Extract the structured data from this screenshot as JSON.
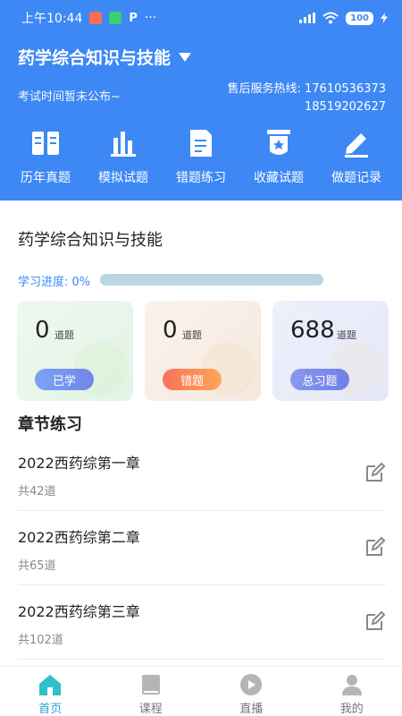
{
  "status_bar": {
    "time": "上午10:44",
    "more": "···",
    "battery": "100"
  },
  "header": {
    "subject": "药学综合知识与技能",
    "dropdown_icon": "triangle-down",
    "exam_time": "考试时间暂未公布~",
    "hotline_label_1": "售后服务热线: 17610536373",
    "hotline_2": "18519202627"
  },
  "nav": {
    "items": [
      {
        "label": "历年真题",
        "icon": "book-icon"
      },
      {
        "label": "模拟试题",
        "icon": "bar-chart-icon"
      },
      {
        "label": "错题练习",
        "icon": "document-icon"
      },
      {
        "label": "收藏试题",
        "icon": "bookmark-icon"
      },
      {
        "label": "做题记录",
        "icon": "pencil-icon"
      }
    ]
  },
  "main": {
    "title": "药学综合知识与技能",
    "progress_label": "学习进度: 0%",
    "progress": 0,
    "stats": [
      {
        "value": "0",
        "unit": "道题",
        "badge": "已学"
      },
      {
        "value": "0",
        "unit": "道题",
        "badge": "错题"
      },
      {
        "value": "688",
        "unit": "道题",
        "badge": "总习题"
      }
    ],
    "section_title": "章节练习",
    "chapters": [
      {
        "name": "2022西药综第一章",
        "count": "共42道"
      },
      {
        "name": "2022西药综第二章",
        "count": "共65道"
      },
      {
        "name": "2022西药综第三章",
        "count": "共102道"
      }
    ]
  },
  "bottom_nav": {
    "tabs": [
      {
        "label": "首页",
        "icon": "home-icon",
        "active": true
      },
      {
        "label": "课程",
        "icon": "course-book-icon",
        "active": false
      },
      {
        "label": "直播",
        "icon": "play-icon",
        "active": false
      },
      {
        "label": "我的",
        "icon": "user-icon",
        "active": false
      }
    ]
  },
  "colors": {
    "primary": "#3d88f5",
    "active_tab": "#2f9ee0"
  }
}
